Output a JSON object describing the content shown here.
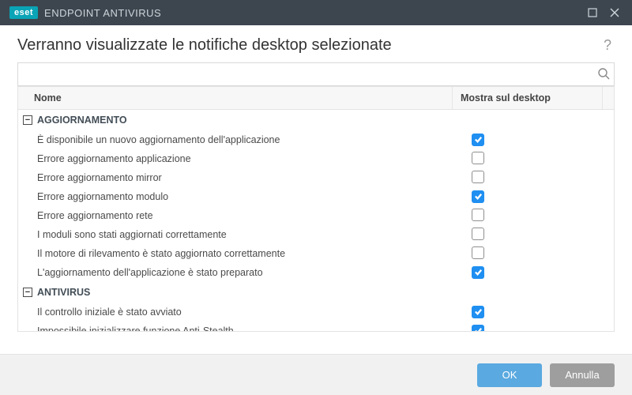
{
  "titlebar": {
    "logo": "eset",
    "appname": "ENDPOINT ANTIVIRUS"
  },
  "header": {
    "title": "Verranno visualizzate le notifiche desktop selezionate",
    "help": "?"
  },
  "search": {
    "value": "",
    "placeholder": ""
  },
  "columns": {
    "name": "Nome",
    "show": "Mostra sul desktop"
  },
  "groups": [
    {
      "label": "AGGIORNAMENTO",
      "items": [
        {
          "label": "È disponibile un nuovo aggiornamento dell'applicazione",
          "checked": true
        },
        {
          "label": "Errore aggiornamento applicazione",
          "checked": false
        },
        {
          "label": "Errore aggiornamento mirror",
          "checked": false
        },
        {
          "label": "Errore aggiornamento modulo",
          "checked": true
        },
        {
          "label": "Errore aggiornamento rete",
          "checked": false
        },
        {
          "label": "I moduli sono stati aggiornati correttamente",
          "checked": false
        },
        {
          "label": "Il motore di rilevamento è stato aggiornato correttamente",
          "checked": false
        },
        {
          "label": "L'aggiornamento dell'applicazione è stato preparato",
          "checked": true
        }
      ]
    },
    {
      "label": "ANTIVIRUS",
      "items": [
        {
          "label": "Il controllo iniziale è stato avviato",
          "checked": true
        },
        {
          "label": "Impossibile inizializzare funzione Anti-Stealth",
          "checked": true
        }
      ]
    }
  ],
  "footer": {
    "ok": "OK",
    "cancel": "Annulla"
  }
}
